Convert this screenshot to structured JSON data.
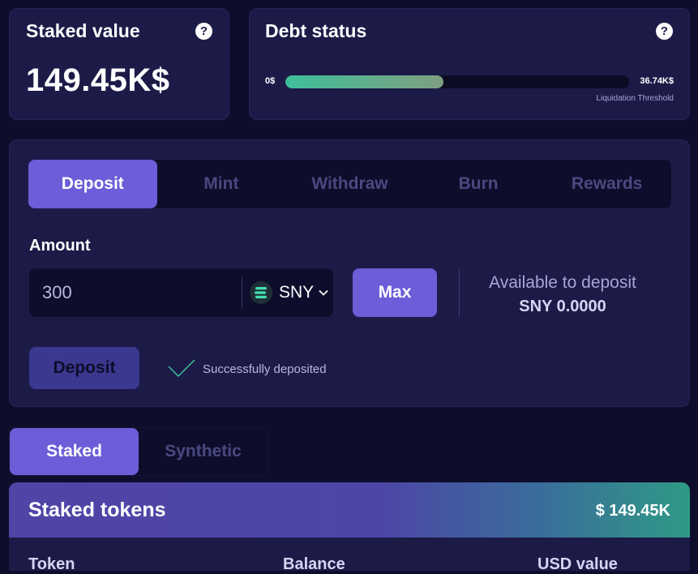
{
  "staked": {
    "title": "Staked value",
    "amount": "149.45K$",
    "help": "?"
  },
  "debt": {
    "title": "Debt status",
    "help": "?",
    "min_label": "0$",
    "max_label": "36.74K$",
    "threshold_label": "Liquidation Threshold",
    "fill_fraction": 0.46,
    "fill_colors": [
      "#3fbf9b",
      "#7f9f80"
    ]
  },
  "tabs": [
    {
      "label": "Deposit",
      "active": true
    },
    {
      "label": "Mint",
      "active": false
    },
    {
      "label": "Withdraw",
      "active": false
    },
    {
      "label": "Burn",
      "active": false
    },
    {
      "label": "Rewards",
      "active": false
    }
  ],
  "form": {
    "amount_label": "Amount",
    "amount_value": "300",
    "token_symbol": "SNY",
    "max_label": "Max",
    "available_label": "Available to deposit",
    "available_value": "SNY 0.0000",
    "submit_label": "Deposit",
    "status_text": "Successfully deposited"
  },
  "bottom_tabs": [
    {
      "label": "Staked",
      "active": true
    },
    {
      "label": "Synthetic",
      "active": false
    }
  ],
  "tokens": {
    "title": "Staked tokens",
    "total": "$ 149.45K",
    "columns": [
      "Token",
      "Balance",
      "USD value"
    ]
  },
  "colors": {
    "accent": "#6c5dd8",
    "background": "#0e0d2b",
    "card": "#1c1b48",
    "success": "#3fbfa0"
  },
  "icons": {
    "help": "question-circle-icon",
    "token": "sny-token-logo-icon",
    "chevron": "chevron-down-icon",
    "success": "checkmark-icon"
  }
}
